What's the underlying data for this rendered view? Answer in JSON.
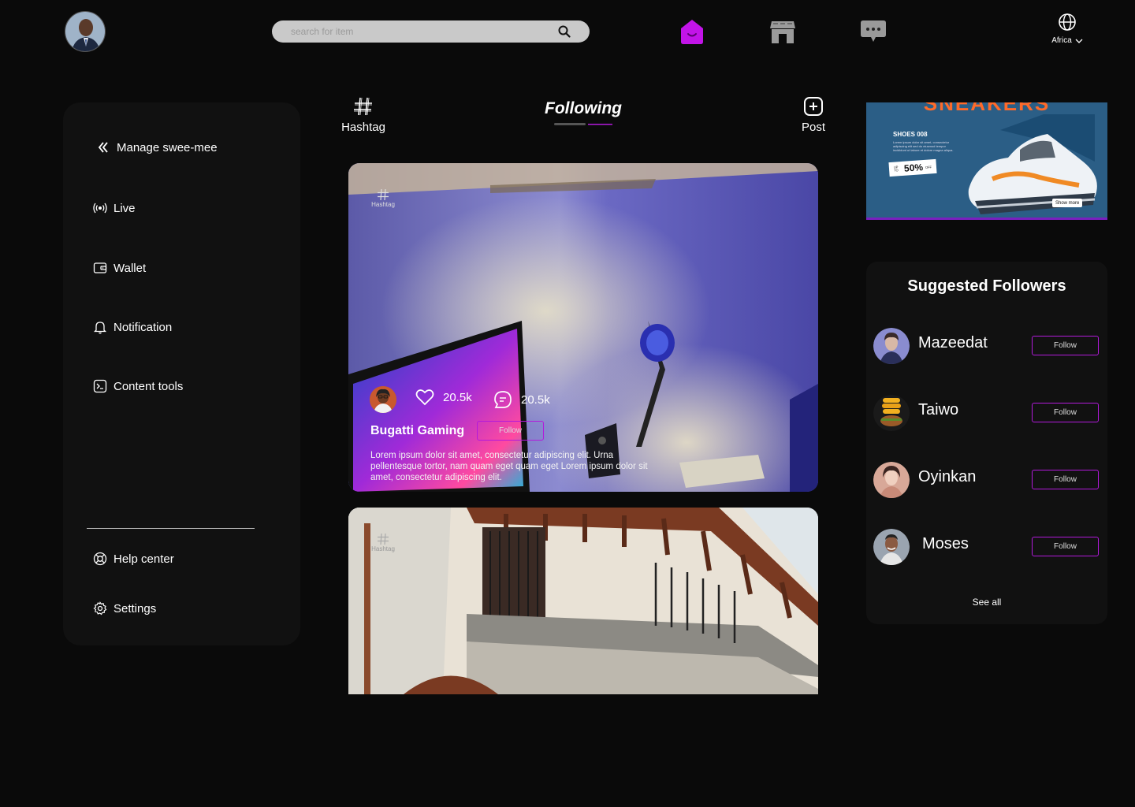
{
  "header": {
    "search_placeholder": "search for item",
    "language_label": "Africa"
  },
  "sidebar": {
    "items": [
      {
        "label": "Manage swee-mee",
        "icon": "chevrons-left-icon"
      },
      {
        "label": "Live",
        "icon": "live-broadcast-icon"
      },
      {
        "label": "Wallet",
        "icon": "wallet-icon"
      },
      {
        "label": "Notification",
        "icon": "bell-icon"
      },
      {
        "label": "Content tools",
        "icon": "terminal-icon"
      }
    ],
    "bottom_items": [
      {
        "label": "Help center",
        "icon": "lifebuoy-icon"
      },
      {
        "label": "Settings",
        "icon": "gear-icon"
      }
    ]
  },
  "feed_header": {
    "hashtag_label": "Hashtag",
    "title": "Following",
    "post_label": "Post"
  },
  "posts": [
    {
      "tag_label": "Hashtag",
      "likes": "20.5k",
      "comments": "20.5k",
      "author": "Bugatti Gaming",
      "follow_label": "Follow",
      "caption": "Lorem ipsum dolor sit amet, consectetur adipiscing elit. Urna pellentesque tortor, nam quam eget  quam eget Lorem ipsum dolor sit amet, consectetur adipiscing elit."
    },
    {
      "tag_label": "Hashtag"
    }
  ],
  "ad": {
    "headline": "SNEAKERS",
    "product": "SHOES 008",
    "body": "Lorem ipsum dolor sit amet, consectetur adipiscing elit sed do eiusmod tempor incididunt ut labore et dolore magna aliqua.",
    "discount_prefix": "UP TO",
    "discount": "50%",
    "discount_suffix": "OFF",
    "cta": "Show more"
  },
  "suggested": {
    "title": "Suggested Followers",
    "follow_label": "Follow",
    "see_all": "See all",
    "users": [
      {
        "name": "Mazeedat"
      },
      {
        "name": "Taiwo"
      },
      {
        "name": "Oyinkan"
      },
      {
        "name": "Moses"
      }
    ]
  },
  "colors": {
    "accent": "#b21adb",
    "background": "#0a0a0a",
    "panel": "#111111"
  }
}
